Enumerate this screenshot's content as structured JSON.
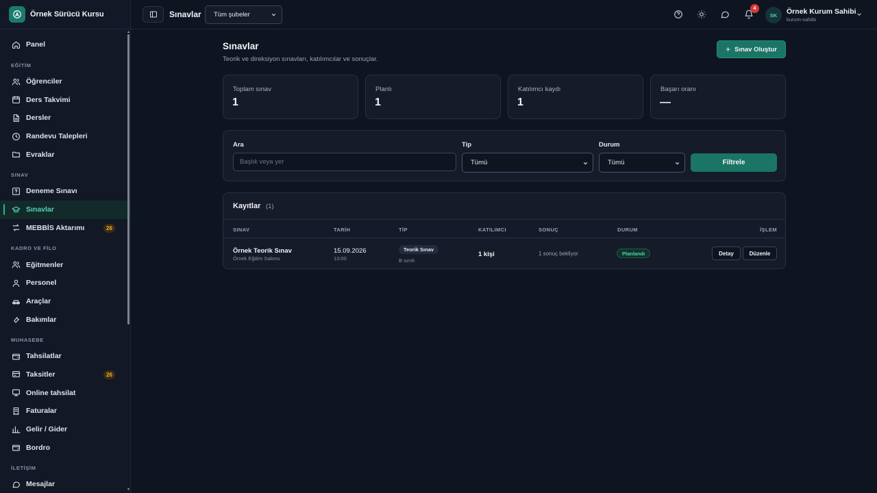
{
  "brand": {
    "name": "Örnek Sürücü Kursu"
  },
  "sidebar": {
    "items": [
      {
        "type": "item",
        "label": "Panel",
        "icon": "home-icon"
      },
      {
        "type": "section",
        "label": "EĞİTİM"
      },
      {
        "type": "item",
        "label": "Öğrenciler",
        "icon": "users-icon"
      },
      {
        "type": "item",
        "label": "Ders Takvimi",
        "icon": "calendar-icon"
      },
      {
        "type": "item",
        "label": "Dersler",
        "icon": "document-icon"
      },
      {
        "type": "item",
        "label": "Randevu Talepleri",
        "icon": "clock-icon"
      },
      {
        "type": "item",
        "label": "Evraklar",
        "icon": "folder-icon"
      },
      {
        "type": "section",
        "label": "SINAV"
      },
      {
        "type": "item",
        "label": "Deneme Sınavı",
        "icon": "help-square-icon"
      },
      {
        "type": "item",
        "label": "Sınavlar",
        "icon": "graduation-cap-icon",
        "active": true
      },
      {
        "type": "item",
        "label": "MEBBİS Aktarımı",
        "icon": "transfer-icon",
        "badge": "26"
      },
      {
        "type": "section",
        "label": "KADRO VE FİLO"
      },
      {
        "type": "item",
        "label": "Eğitmenler",
        "icon": "users-icon"
      },
      {
        "type": "item",
        "label": "Personel",
        "icon": "user-icon"
      },
      {
        "type": "item",
        "label": "Araçlar",
        "icon": "car-icon"
      },
      {
        "type": "item",
        "label": "Bakımlar",
        "icon": "wrench-icon"
      },
      {
        "type": "section",
        "label": "MUHASEBE"
      },
      {
        "type": "item",
        "label": "Tahsilatlar",
        "icon": "wallet-icon"
      },
      {
        "type": "item",
        "label": "Taksitler",
        "icon": "credit-card-icon",
        "badge": "26"
      },
      {
        "type": "item",
        "label": "Online tahsilat",
        "icon": "monitor-icon"
      },
      {
        "type": "item",
        "label": "Faturalar",
        "icon": "receipt-icon"
      },
      {
        "type": "item",
        "label": "Gelir / Gider",
        "icon": "bar-chart-icon"
      },
      {
        "type": "item",
        "label": "Bordro",
        "icon": "wallet-icon"
      },
      {
        "type": "section",
        "label": "İLETİŞİM"
      },
      {
        "type": "item",
        "label": "Mesajlar",
        "icon": "message-icon"
      }
    ]
  },
  "topbar": {
    "title": "Sınavlar",
    "branch_select": "Tüm şubeler",
    "notification_count": "4",
    "user": {
      "initials": "SK",
      "name": "Örnek Kurum Sahibi",
      "role": "kurum-sahibi"
    }
  },
  "page": {
    "title": "Sınavlar",
    "subtitle": "Teorik ve direksiyon sınavları, katılımcılar ve sonuçlar.",
    "create_button": "Sınav Oluştur"
  },
  "stats": [
    {
      "label": "Toplam sınav",
      "value": "1"
    },
    {
      "label": "Planlı",
      "value": "1"
    },
    {
      "label": "Katılımcı kaydı",
      "value": "1"
    },
    {
      "label": "Başarı oranı",
      "value": "—"
    }
  ],
  "filters": {
    "search_label": "Ara",
    "search_placeholder": "Başlık veya yer",
    "type_label": "Tip",
    "type_value": "Tümü",
    "status_label": "Durum",
    "status_value": "Tümü",
    "filter_button": "Filtrele"
  },
  "records": {
    "title": "Kayıtlar",
    "count": "(1)",
    "columns": [
      "SINAV",
      "TARİH",
      "TİP",
      "KATILIMCI",
      "SONUÇ",
      "DURUM",
      "İŞLEM"
    ],
    "rows": [
      {
        "exam_name": "Örnek Teorik Sınav",
        "exam_place": "Örnek Eğitim Salonu",
        "date": "15.09.2026",
        "time": "13:00",
        "type": "Teorik Sınav",
        "class": "B sınıfı",
        "participants": "1 kişi",
        "result": "1 sonuç bekliyor",
        "status": "Planlandı",
        "detail_button": "Detay",
        "edit_button": "Düzenle"
      }
    ]
  },
  "colors": {
    "accent": "#1a7565",
    "accent_text": "#4fd1b5",
    "background": "#0f1421",
    "badge_red": "#d63a3a",
    "badge_amber": "#f0b53a"
  }
}
